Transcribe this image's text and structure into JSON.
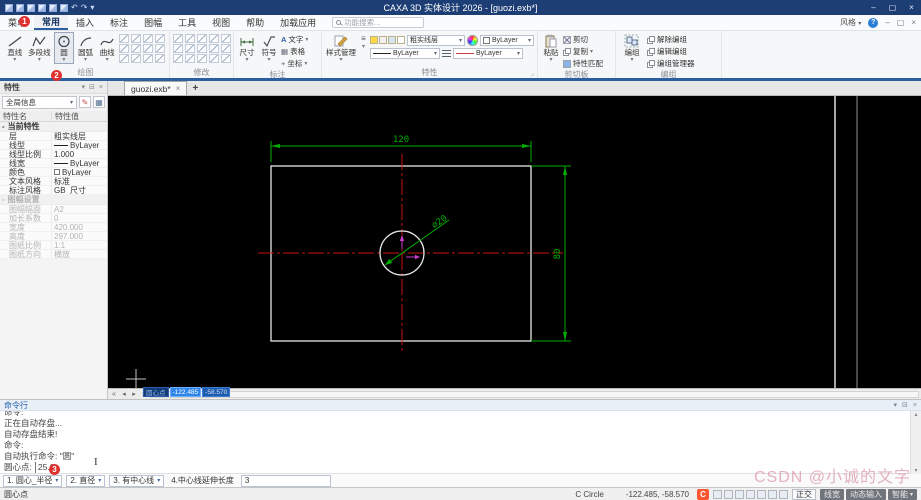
{
  "window": {
    "title": "CAXA 3D 实体设计 2026 - [guozi.exb*]",
    "controls": {
      "minimize": "–",
      "maximize": "▢",
      "close": "×"
    }
  },
  "menubar": {
    "items": [
      "菜单",
      "常用",
      "插入",
      "标注",
      "图幅",
      "工具",
      "视图",
      "帮助",
      "加载应用"
    ],
    "active": "常用",
    "search_placeholder": "功能搜索...",
    "style_button": "风格",
    "help": "?"
  },
  "ribbon": {
    "draw": {
      "label": "绘图",
      "tools": [
        "直线",
        "多段线",
        "圆",
        "圆弧",
        "曲线"
      ],
      "active_tool": "圆"
    },
    "modify": {
      "label": "修改"
    },
    "annotate": {
      "label": "标注",
      "dim": "尺寸",
      "symbol": "符号",
      "text": "文字",
      "table": "表格",
      "coord": "坐标"
    },
    "props": {
      "label": "特性",
      "style_manager": "样式管理",
      "layer": "粗实线层",
      "linetype_value": "ByLayer",
      "linewidth_value": "ByLayer",
      "color_value": "ByLayer"
    },
    "clipboard": {
      "label": "剪切板",
      "paste": "粘贴",
      "cut": "剪切",
      "copy": "复制",
      "match": "特性匹配"
    },
    "group": {
      "label": "编组",
      "group_btn": "编组",
      "ungroup": "解除编组",
      "edit_group": "编辑编组",
      "manager": "编组管理器"
    }
  },
  "properties_panel": {
    "title": "特性",
    "scope": "全局信息",
    "columns": {
      "name": "特性名",
      "value": "特性值"
    },
    "sections": [
      {
        "title": "当前特性",
        "disabled": false,
        "rows": [
          {
            "name": "层",
            "value": "粗实线层"
          },
          {
            "name": "线型",
            "value": "ByLayer",
            "glyph": "line"
          },
          {
            "name": "线型比例",
            "value": "1.000"
          },
          {
            "name": "线宽",
            "value": "ByLayer",
            "glyph": "line"
          },
          {
            "name": "颜色",
            "value": "ByLayer",
            "glyph": "color"
          },
          {
            "name": "文本风格",
            "value": "标准"
          },
          {
            "name": "标注风格",
            "value": "GB_尺寸"
          }
        ]
      },
      {
        "title": "图幅设置",
        "disabled": true,
        "rows": [
          {
            "name": "图幅幅面",
            "value": "A2"
          },
          {
            "name": "加长系数",
            "value": "0"
          },
          {
            "name": "宽度",
            "value": "420.000"
          },
          {
            "name": "高度",
            "value": "297.000"
          },
          {
            "name": "图纸比例",
            "value": "1:1"
          },
          {
            "name": "图纸方向",
            "value": "横放"
          }
        ]
      }
    ]
  },
  "document": {
    "tab_label": "guozi.exb*",
    "close": "×",
    "new_tab": "+"
  },
  "canvas": {
    "dim_width": "120",
    "dim_height": "80",
    "dim_diameter": "∅20",
    "coord_label": "圆心点",
    "coord_x": "-122.485",
    "coord_y": "-58.570"
  },
  "command": {
    "title": "命令行",
    "log": [
      "命令:",
      "正在自动存盘...",
      "自动存盘结束!",
      "命令:",
      "自动执行命令: \"圆\""
    ],
    "prompt_label": "圆心点:",
    "prompt_value": "25.0",
    "options": [
      {
        "label": "1. 圆心_半径",
        "dropdown": true
      },
      {
        "label": "2. 直径",
        "dropdown": true
      },
      {
        "label": "3. 有中心线",
        "dropdown": true
      },
      {
        "label": "4.中心线延伸长度",
        "input": "3"
      }
    ]
  },
  "statusbar": {
    "prompt": "圆心点",
    "mode": "C Circle",
    "coords": "-122.485, -58.570",
    "ortho": "正交",
    "buttons": [
      "线宽",
      "动态输入",
      "智能"
    ]
  },
  "annotations": {
    "step1": "1",
    "step2": "2",
    "step3": "3"
  },
  "watermark": {
    "text": "CSDN @小诚的文字",
    "logo": "C"
  },
  "glyphs": {
    "caret": "▾",
    "close": "×",
    "min": "–",
    "max": "▢",
    "pin": "⊟",
    "up": "▴",
    "down": "▾",
    "left": "◂",
    "right": "▸",
    "dleft": "«",
    "dright": "»",
    "launcher": "⌟",
    "text_icon": "A",
    "table_icon": "▦",
    "coord_icon": "+",
    "layers_icon": "≡",
    "ibeam": "I",
    "undo": "↶",
    "redo": "↷",
    "more": "⋯"
  },
  "colors": {
    "titlebar": "#1d3e75",
    "accent": "#2b5fa0",
    "dim_green": "#00b000",
    "centerline_red": "#cc1111",
    "magenta": "#cc3ccc",
    "csdn_red": "#fc5531"
  }
}
